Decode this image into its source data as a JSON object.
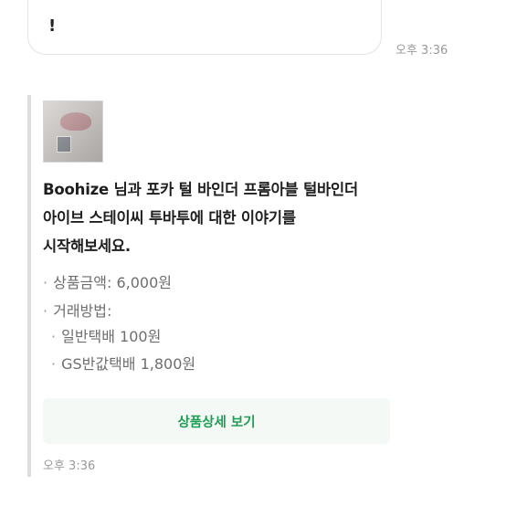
{
  "previous_message": {
    "line1": "",
    "line2": "!",
    "time": "오후 3:36"
  },
  "product_card": {
    "thumbnail_icon": "product-photo",
    "intro_lines": [
      "Boohize 님과 포카 털 바인더 프롬아블 털바인더",
      "아이브 스테이씨 투바투에 대한 이야기를",
      "시작해보세요."
    ],
    "price_label": "상품금액: 6,000원",
    "trade_label": "거래방법:",
    "trade_methods": [
      "일반택배 100원",
      "GS반값택배 1,800원"
    ],
    "view_button_label": "상품상세 보기",
    "time": "오후 3:36",
    "accent_color": "#1f9d55"
  }
}
